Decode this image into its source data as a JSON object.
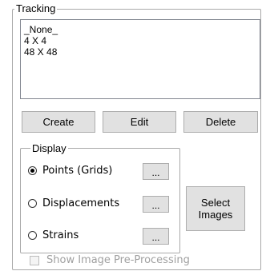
{
  "tracking": {
    "title": "Tracking",
    "list_items": [
      "_None_",
      "4 X 4",
      "48 X 48"
    ],
    "create_label": "Create",
    "edit_label": "Edit",
    "delete_label": "Delete"
  },
  "display": {
    "title": "Display",
    "options": [
      {
        "label": "Points (Grids)",
        "selected": true
      },
      {
        "label": "Displacements",
        "selected": false
      },
      {
        "label": "Strains",
        "selected": false
      }
    ],
    "ellipsis_label": "...",
    "select_images_label": "Select Images"
  },
  "show_preprocessing": {
    "label": "Show Image Pre-Processing",
    "checked": false,
    "enabled": false
  }
}
